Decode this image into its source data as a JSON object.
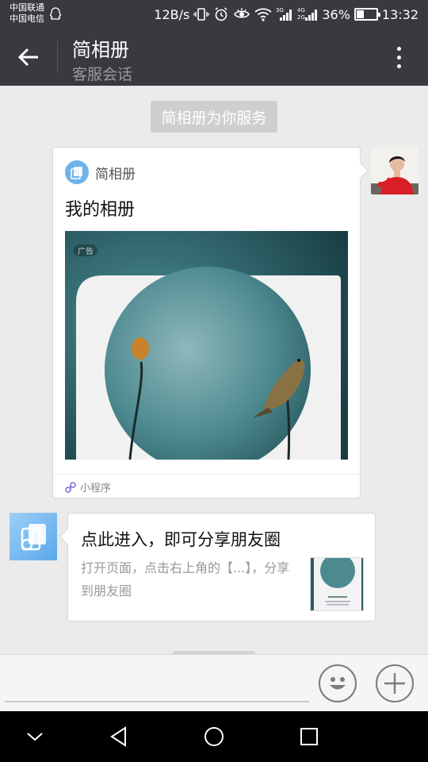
{
  "status_bar": {
    "carrier_1": "中国联通",
    "carrier_2": "中国电信",
    "network_speed": "12B/s",
    "battery_percent": "36%",
    "battery_level": 0.36,
    "time": "13:32",
    "icons": [
      "qq-icon",
      "vibrate-icon",
      "alarm-icon",
      "eye-icon",
      "wifi-icon",
      "signal-3g-icon",
      "signal-4g-icon",
      "battery-icon"
    ]
  },
  "header": {
    "title": "简相册",
    "subtitle": "客服会话",
    "back_icon": "arrow-left-icon",
    "menu_icon": "more-vertical-icon"
  },
  "system_message": "简相册为你服务",
  "mini_program_card": {
    "app_name": "简相册",
    "title": "我的相册",
    "ad_label": "广告",
    "footer_label": "小程序",
    "footer_icon": "mini-program-icon"
  },
  "service_card": {
    "title": "点此进入，即可分享朋友圈",
    "description": "打开页面，点击右上角的【...】，分享到朋友圈"
  },
  "input_bar": {
    "emoji_icon": "emoji-icon",
    "plus_icon": "plus-icon"
  },
  "system_nav": {
    "icons": [
      "chevron-down-icon",
      "back-triangle-icon",
      "home-circle-icon",
      "recents-square-icon"
    ]
  },
  "colors": {
    "header_bg": "#393a3f",
    "chat_bg": "#ebebeb",
    "accent_blue": "#5aa8ea"
  }
}
